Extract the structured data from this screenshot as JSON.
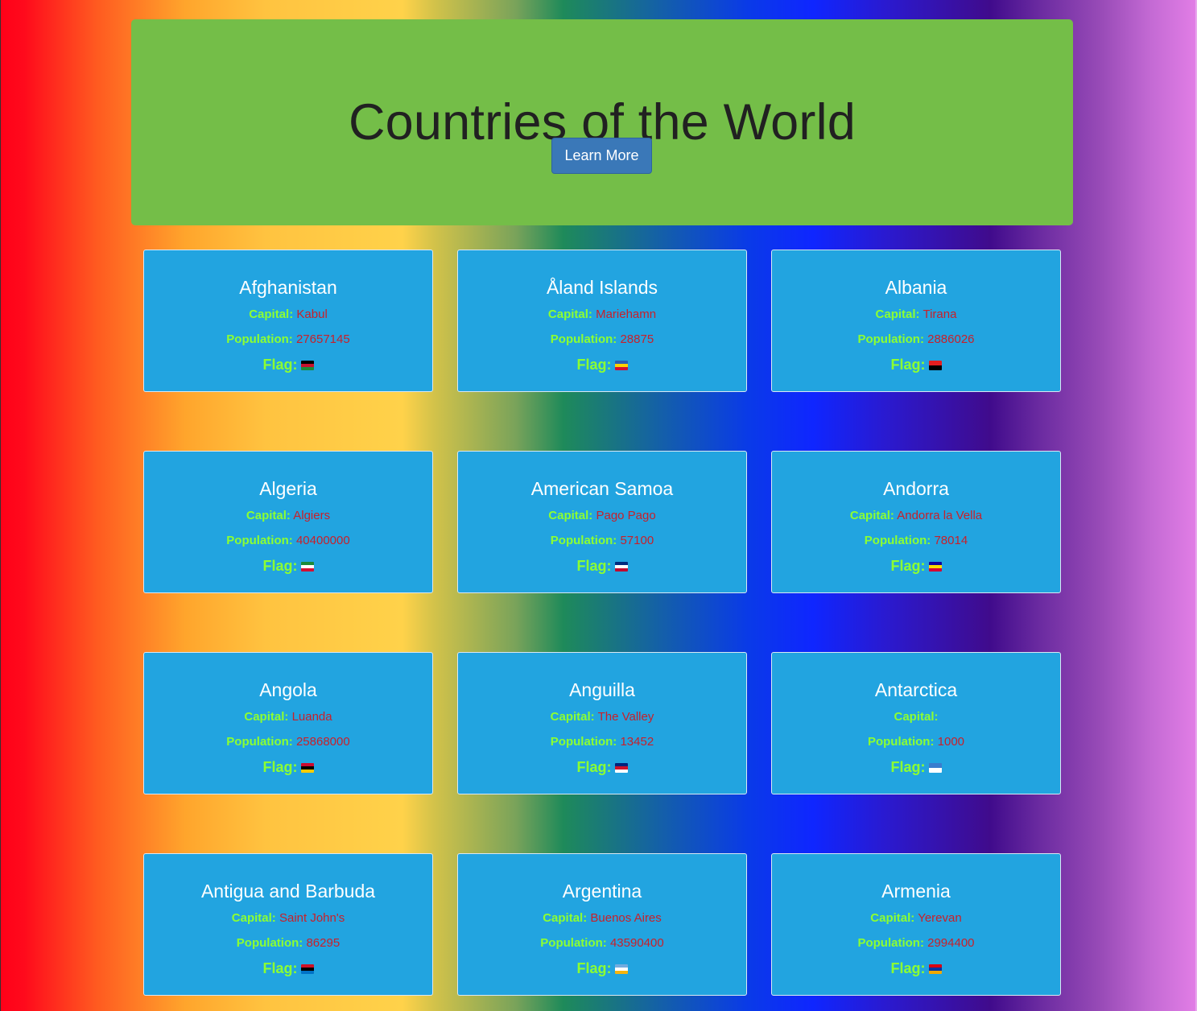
{
  "header": {
    "title": "Countries of the World",
    "button_label": "Learn More"
  },
  "labels": {
    "capital": "Capital:",
    "population": "Population:",
    "flag": "Flag:"
  },
  "countries": [
    {
      "name": "Afghanistan",
      "capital": "Kabul",
      "population": "27657145",
      "flag_icon": "afghanistan-flag-icon",
      "flag_colors": [
        "#000000",
        "#c8102e",
        "#1a8a3a"
      ]
    },
    {
      "name": "Åland Islands",
      "capital": "Mariehamn",
      "population": "28875",
      "flag_icon": "aland-islands-flag-icon",
      "flag_colors": [
        "#2c5fb4",
        "#ffd200",
        "#d21034"
      ]
    },
    {
      "name": "Albania",
      "capital": "Tirana",
      "population": "2886026",
      "flag_icon": "albania-flag-icon",
      "flag_colors": [
        "#e41e20",
        "#000000"
      ]
    },
    {
      "name": "Algeria",
      "capital": "Algiers",
      "population": "40400000",
      "flag_icon": "algeria-flag-icon",
      "flag_colors": [
        "#1a8a3a",
        "#ffffff",
        "#d21034"
      ]
    },
    {
      "name": "American Samoa",
      "capital": "Pago Pago",
      "population": "57100",
      "flag_icon": "american-samoa-flag-icon",
      "flag_colors": [
        "#002b7f",
        "#ffffff",
        "#bf0a30"
      ]
    },
    {
      "name": "Andorra",
      "capital": "Andorra la Vella",
      "population": "78014",
      "flag_icon": "andorra-flag-icon",
      "flag_colors": [
        "#10069f",
        "#fedd00",
        "#d50032"
      ]
    },
    {
      "name": "Angola",
      "capital": "Luanda",
      "population": "25868000",
      "flag_icon": "angola-flag-icon",
      "flag_colors": [
        "#cc092f",
        "#000000",
        "#ffcb00"
      ]
    },
    {
      "name": "Anguilla",
      "capital": "The Valley",
      "population": "13452",
      "flag_icon": "anguilla-flag-icon",
      "flag_colors": [
        "#00247d",
        "#cf142b",
        "#ffffff"
      ]
    },
    {
      "name": "Antarctica",
      "capital": "",
      "population": "1000",
      "flag_icon": "antarctica-flag-icon",
      "flag_colors": [
        "#3a7dce",
        "#ffffff"
      ]
    },
    {
      "name": "Antigua and Barbuda",
      "capital": "Saint John's",
      "population": "86295",
      "flag_icon": "antigua-and-barbuda-flag-icon",
      "flag_colors": [
        "#ce1126",
        "#000000",
        "#0072c6"
      ]
    },
    {
      "name": "Argentina",
      "capital": "Buenos Aires",
      "population": "43590400",
      "flag_icon": "argentina-flag-icon",
      "flag_colors": [
        "#74acdf",
        "#ffffff",
        "#f6b40e"
      ]
    },
    {
      "name": "Armenia",
      "capital": "Yerevan",
      "population": "2994400",
      "flag_icon": "armenia-flag-icon",
      "flag_colors": [
        "#d90012",
        "#0033a0",
        "#f2a800"
      ]
    }
  ]
}
